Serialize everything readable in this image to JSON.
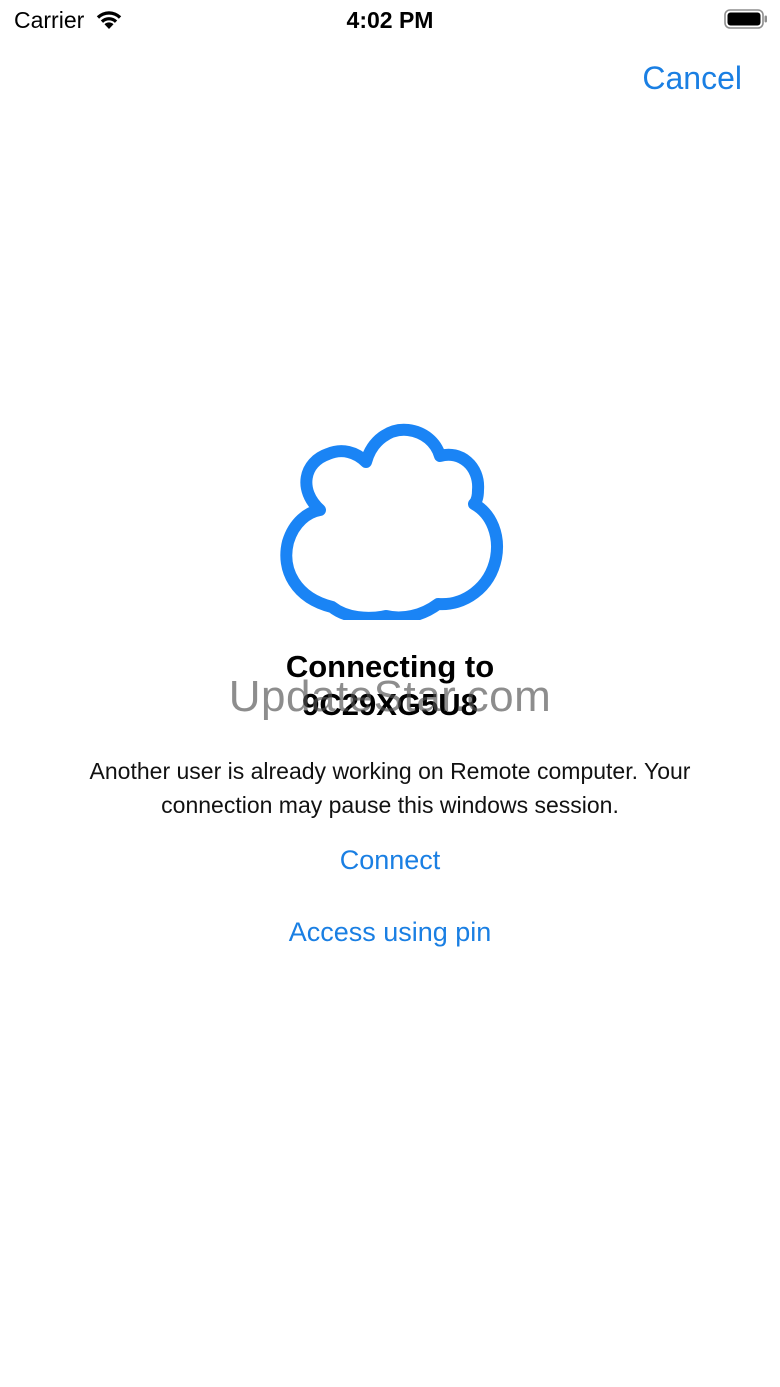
{
  "status_bar": {
    "carrier": "Carrier",
    "time": "4:02 PM"
  },
  "nav": {
    "cancel_label": "Cancel"
  },
  "connection": {
    "title_line1": "Connecting to",
    "title_line2": "9C29XG5U8",
    "message": "Another user is already working on Remote computer. Your connection may pause this windows session."
  },
  "actions": {
    "connect_label": "Connect",
    "pin_label": "Access using pin"
  },
  "watermark": "UpdateStar.com",
  "colors": {
    "accent": "#1a7fe3",
    "cloud": "#1a84f5"
  }
}
